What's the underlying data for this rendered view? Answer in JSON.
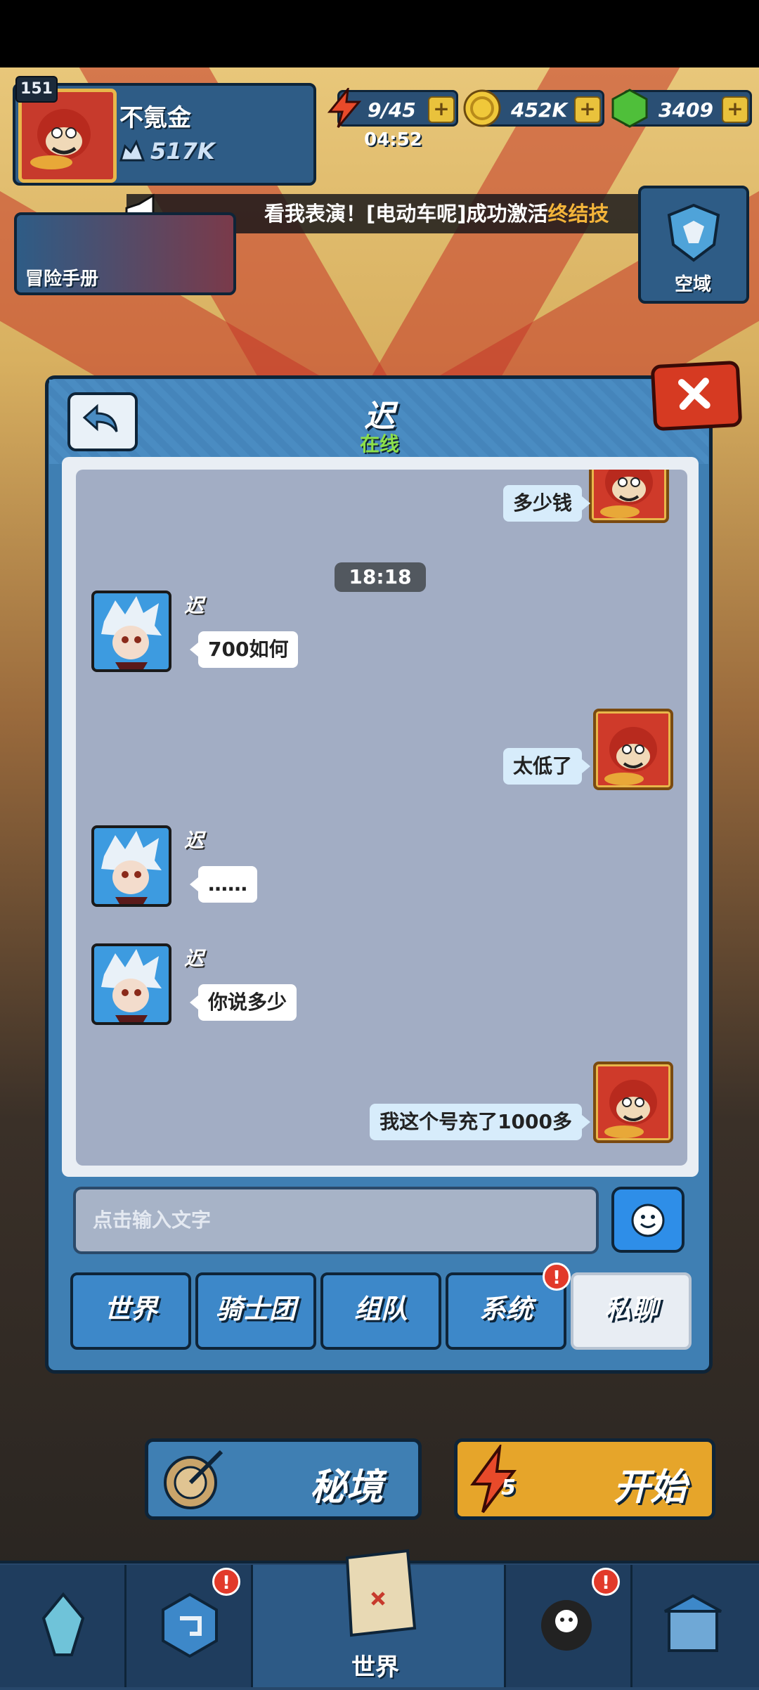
{
  "player": {
    "level": "151",
    "name": "不氪金",
    "power": "517K"
  },
  "resources": {
    "energy": "9/45",
    "energy_timer": "04:52",
    "gold": "452K",
    "gems": "3409",
    "plus": "+"
  },
  "announcement": {
    "prefix": "看我表演！[电动车呢]成功激活",
    "highlight": "终结技"
  },
  "side_buttons": {
    "adventure_book": "冒险手册",
    "sky_domain": "空域"
  },
  "chat": {
    "title": "迟",
    "status": "在线",
    "timestamp": "18:18",
    "messages": [
      {
        "text": "多少钱"
      },
      {
        "sender": "迟",
        "text": "700如何"
      },
      {
        "text": "太低了"
      },
      {
        "sender": "迟",
        "text": "……"
      },
      {
        "sender": "迟",
        "text": "你说多少"
      },
      {
        "text": "我这个号充了1000多"
      }
    ],
    "input_placeholder": "点击输入文字",
    "tabs": [
      "世界",
      "骑士团",
      "组队",
      "系统",
      "私聊"
    ],
    "system_badge": "!"
  },
  "bottom": {
    "secret_realm": "秘境",
    "start": "开始",
    "start_cost": "5"
  },
  "nav": {
    "world_label": "世界",
    "badge": "!"
  },
  "colors": {
    "accent": "#3f7fb3",
    "close": "#d63a22",
    "online": "#8de04a",
    "highlight": "#f3b43a"
  }
}
